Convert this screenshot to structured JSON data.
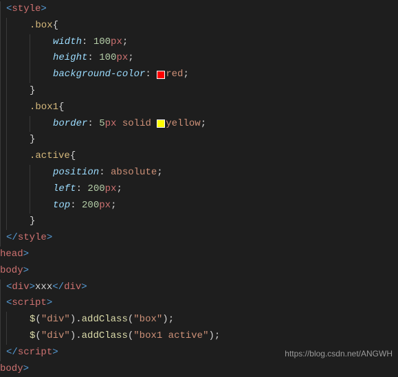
{
  "code": {
    "style_open": "style",
    "style_close": "style",
    "head_close": "head",
    "body_open": "body",
    "body_close": "body",
    "div": "div",
    "div_text": "xxx",
    "script_open": "script",
    "script_close": "script",
    "sel_box": ".box",
    "sel_box1": ".box1",
    "sel_active": ".active",
    "lbrace": "{",
    "rbrace": "}",
    "props": {
      "width": "width",
      "height": "height",
      "bgcolor": "background-color",
      "border": "border",
      "position": "position",
      "left": "left",
      "top": "top"
    },
    "vals": {
      "n100": "100",
      "n5": "5",
      "n200": "200",
      "px": "px",
      "solid": "solid",
      "red": "red",
      "yellow": "yellow",
      "absolute": "absolute"
    },
    "colon": ":",
    "semi": ";",
    "lt": "<",
    "gt": ">",
    "slash": "/",
    "jq": "$",
    "lparen": "(",
    "rparen": ")",
    "dot": ".",
    "addClass": "addClass",
    "str_div": "\"div\"",
    "str_box": "\"box\"",
    "str_box1_active": "\"box1 active\""
  },
  "colors": {
    "red": "#ff0000",
    "yellow": "#ffff00"
  },
  "watermark": "https://blog.csdn.net/ANGWH"
}
